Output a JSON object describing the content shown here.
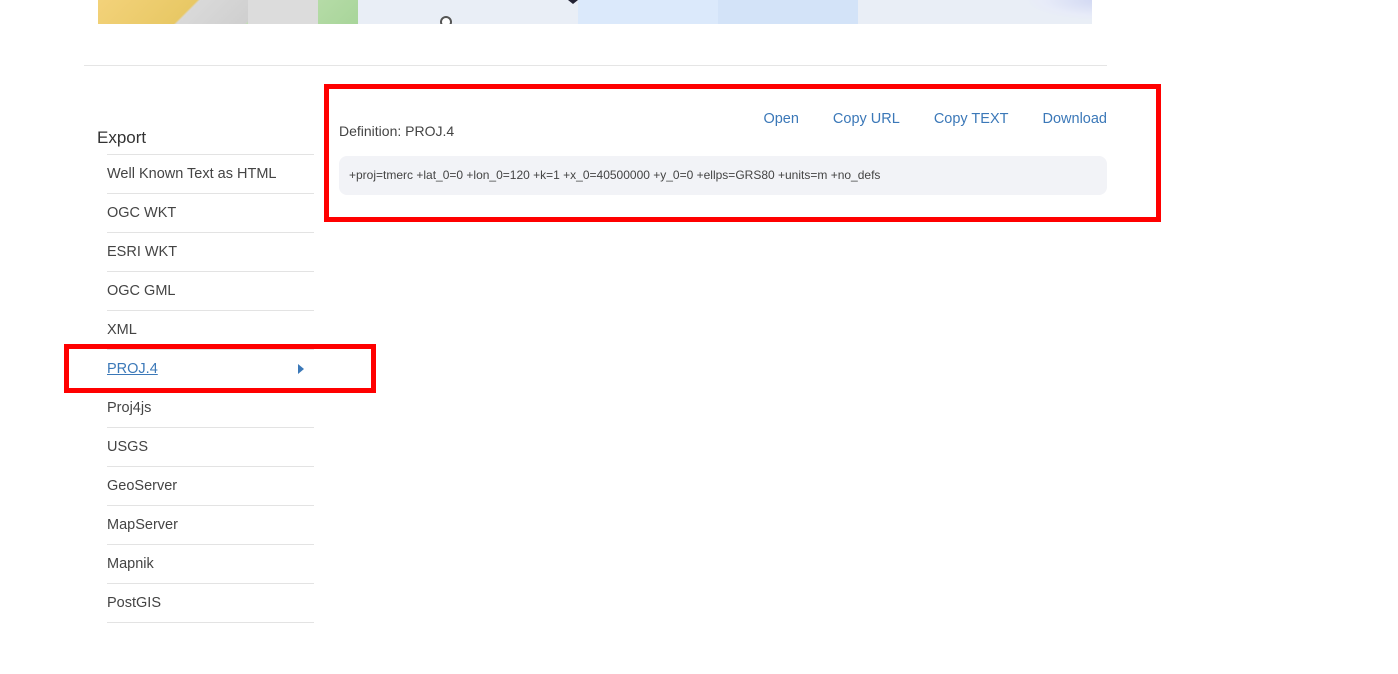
{
  "export": {
    "heading": "Export",
    "items": [
      {
        "label": "Well Known Text as HTML"
      },
      {
        "label": "OGC WKT"
      },
      {
        "label": "ESRI WKT"
      },
      {
        "label": "OGC GML"
      },
      {
        "label": "XML"
      },
      {
        "label": "PROJ.4",
        "active": true
      },
      {
        "label": "Proj4js"
      },
      {
        "label": "USGS"
      },
      {
        "label": "GeoServer"
      },
      {
        "label": "MapServer"
      },
      {
        "label": "Mapnik"
      },
      {
        "label": "PostGIS"
      }
    ]
  },
  "definition": {
    "title": "Definition: PROJ.4",
    "actions": {
      "open": "Open",
      "copy_url": "Copy URL",
      "copy_text": "Copy TEXT",
      "download": "Download"
    },
    "code": "+proj=tmerc +lat_0=0 +lon_0=120 +k=1 +x_0=40500000 +y_0=0 +ellps=GRS80 +units=m +no_defs"
  },
  "colors": {
    "link": "#3b78b8",
    "highlight": "#ff0000",
    "code_bg": "#f2f3f7"
  },
  "icons": {
    "active_caret": "caret-right-icon"
  }
}
